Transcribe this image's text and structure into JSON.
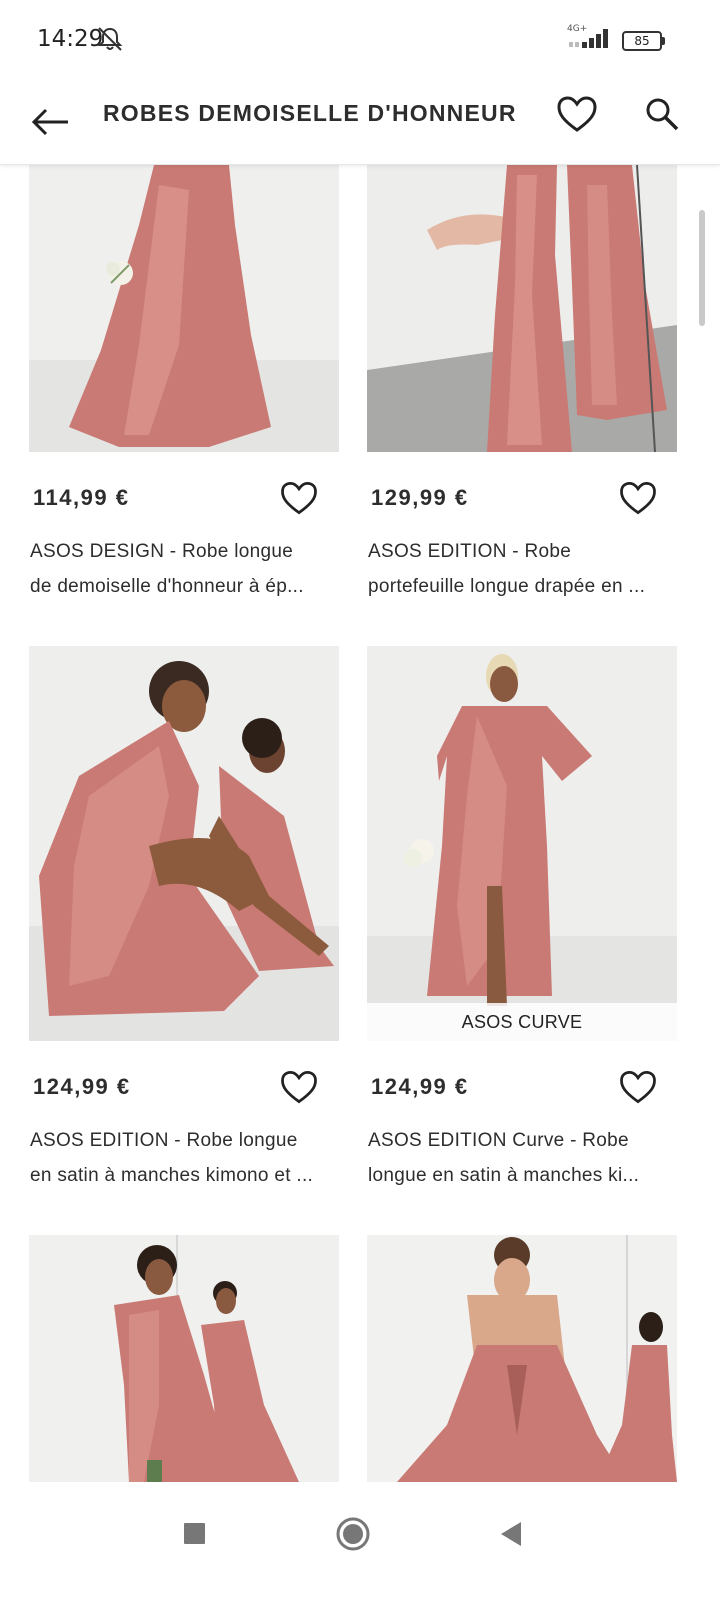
{
  "status_bar": {
    "time": "14:29",
    "network": "4G+",
    "battery": "85"
  },
  "header": {
    "title": "ROBES DEMOISELLE D'HONNEUR"
  },
  "products": [
    {
      "price": "114,99 €",
      "desc_line1": "ASOS DESIGN - Robe longue",
      "desc_line2": "de demoiselle d'honneur à ép...",
      "badge": ""
    },
    {
      "price": "129,99 €",
      "desc_line1": "ASOS EDITION - Robe",
      "desc_line2": "portefeuille longue drapée en ...",
      "badge": ""
    },
    {
      "price": "124,99 €",
      "desc_line1": "ASOS EDITION - Robe longue",
      "desc_line2": "en satin à manches kimono et ...",
      "badge": ""
    },
    {
      "price": "124,99 €",
      "desc_line1": "ASOS EDITION Curve - Robe",
      "desc_line2": "longue en satin à manches ki...",
      "badge": "ASOS CURVE"
    },
    {
      "price": "",
      "desc_line1": "",
      "desc_line2": "",
      "badge": ""
    },
    {
      "price": "",
      "desc_line1": "",
      "desc_line2": "",
      "badge": ""
    }
  ],
  "colors": {
    "dress_pink": "#c97a74",
    "dress_highlight": "#dd9891",
    "background_light": "#ececec",
    "text_dark": "#2d2d2d"
  },
  "icons": {
    "back": "arrow-left",
    "wishlist": "heart-outline",
    "search": "magnifier",
    "nav_recents": "square",
    "nav_home": "circle",
    "nav_back": "triangle-left"
  }
}
